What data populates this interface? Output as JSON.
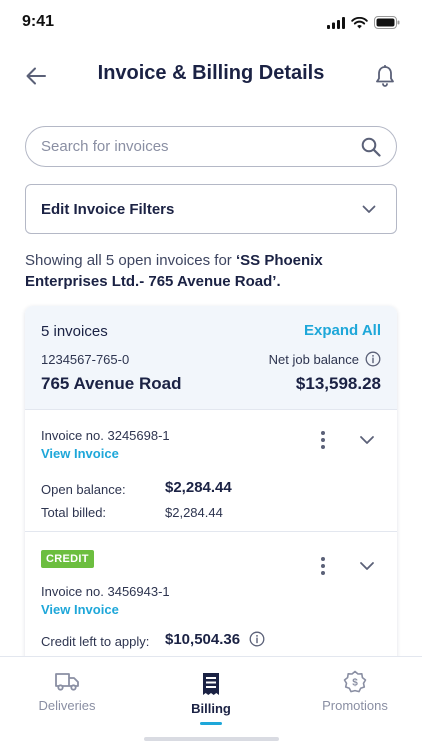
{
  "status_bar": {
    "time": "9:41"
  },
  "header": {
    "title": "Invoice & Billing Details"
  },
  "search": {
    "placeholder": "Search for invoices",
    "value": ""
  },
  "filters": {
    "label": "Edit Invoice Filters"
  },
  "summary": {
    "prefix": "Showing all 5 open invoices for ",
    "account_name": "‘SS Phoenix Enterprises Ltd.- 765 Avenue Road’."
  },
  "account_card": {
    "count": "5 invoices",
    "expand_all": "Expand All",
    "account_number": "1234567-765-0",
    "net_balance_label": "Net job balance",
    "address": "765 Avenue Road",
    "net_balance": "$13,598.28"
  },
  "invoices": [
    {
      "number_label": "Invoice no. 3245698-1",
      "view_label": "View Invoice",
      "rows": [
        {
          "label": "Open balance:",
          "value": "$2,284.44"
        },
        {
          "label": "Total billed:",
          "value": "$2,284.44"
        }
      ]
    },
    {
      "badge": "CREDIT",
      "number_label": "Invoice no. 3456943-1",
      "view_label": "View Invoice",
      "rows": [
        {
          "label": "Credit left to apply:",
          "value": "$10,504.36"
        }
      ]
    }
  ],
  "tabs": [
    {
      "label": "Deliveries",
      "icon": "truck-icon",
      "active": false
    },
    {
      "label": "Billing",
      "icon": "receipt-icon",
      "active": true
    },
    {
      "label": "Promotions",
      "icon": "dollar-badge-icon",
      "active": false
    }
  ],
  "colors": {
    "accent": "#1ea7d9",
    "navy": "#1b2244",
    "credit": "#6cbe3f",
    "header_bg": "#f2f6fb"
  }
}
